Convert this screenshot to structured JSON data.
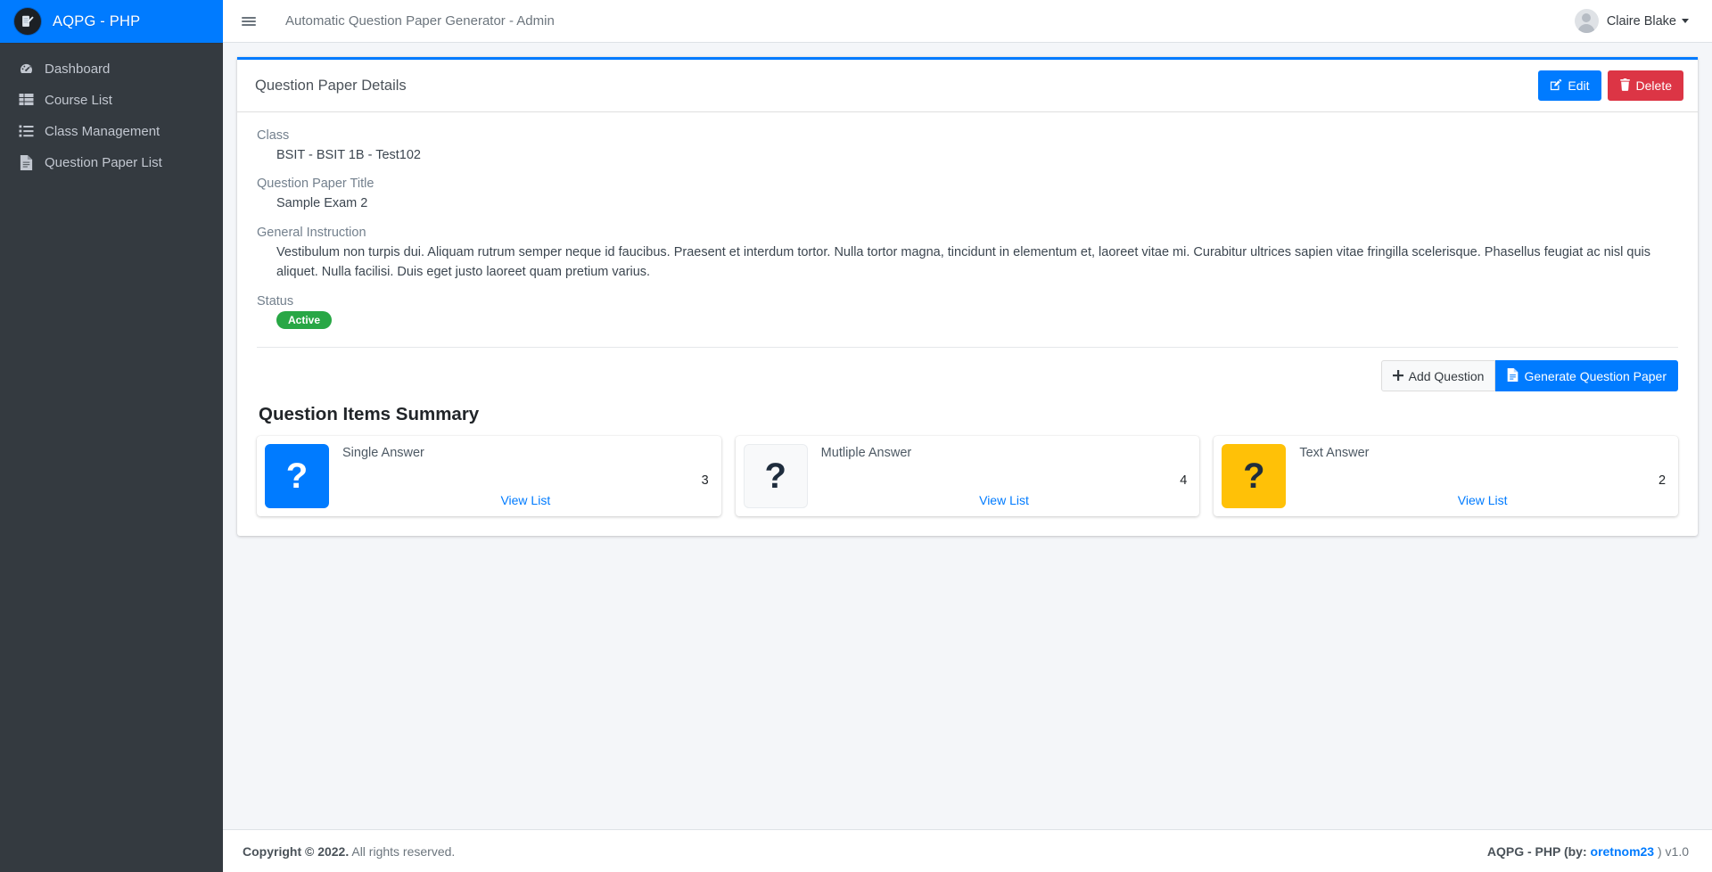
{
  "sidebar": {
    "brand": {
      "title": "AQPG - PHP",
      "logo_icon": "document-pencil-icon"
    },
    "items": [
      {
        "label": "Dashboard",
        "icon": "tachometer-icon"
      },
      {
        "label": "Course List",
        "icon": "table-icon"
      },
      {
        "label": "Class Management",
        "icon": "list-ul-icon"
      },
      {
        "label": "Question Paper List",
        "icon": "file-alt-icon"
      }
    ]
  },
  "topnav": {
    "menu_icon": "hamburger-icon",
    "title": "Automatic Question Paper Generator - Admin",
    "user": {
      "name": "Claire Blake",
      "caret_icon": "caret-down-icon"
    }
  },
  "card": {
    "title": "Question Paper Details",
    "edit_label": "Edit",
    "delete_label": "Delete",
    "fields": [
      {
        "label": "Class",
        "value": "BSIT - BSIT 1B - Test102"
      },
      {
        "label": "Question Paper Title",
        "value": "Sample Exam 2"
      },
      {
        "label": "General Instruction",
        "value": "Vestibulum non turpis dui. Aliquam rutrum semper neque id faucibus. Praesent et interdum tortor. Nulla tortor magna, tincidunt in elementum et, laoreet vitae mi. Curabitur ultrices sapien vitae fringilla scelerisque. Phasellus feugiat ac nisl quis aliquet. Nulla facilisi. Duis eget justo laoreet quam pretium varius."
      },
      {
        "label": "Status",
        "value": "Active"
      }
    ],
    "status_label": "Status",
    "status_value": "Active",
    "add_question_label": "Add Question",
    "generate_label": "Generate Question Paper"
  },
  "summary": {
    "heading": "Question Items Summary",
    "view_list_label": "View List",
    "boxes": [
      {
        "title": "Single Answer",
        "count": "3",
        "color": "#007bff",
        "icon": "question-mark-icon",
        "style": "blue"
      },
      {
        "title": "Mutliple Answer",
        "count": "4",
        "color": "#f8f9fa",
        "icon": "question-mark-icon",
        "style": "light"
      },
      {
        "title": "Text Answer",
        "count": "2",
        "color": "#ffc107",
        "icon": "question-mark-icon",
        "style": "yellow"
      }
    ]
  },
  "footer": {
    "copyright_strong": "Copyright © 2022.",
    "copyright_rest": " All rights reserved.",
    "right_prefix": "AQPG - PHP (by: ",
    "right_link": "oretnom23",
    "right_suffix": " ) v1.0"
  },
  "colors": {
    "brand_blue": "#007bff",
    "sidebar_dark": "#343a40",
    "danger_red": "#dc3545",
    "success_green": "#28a745",
    "warning_yellow": "#ffc107",
    "body_bg": "#f4f6f9"
  }
}
